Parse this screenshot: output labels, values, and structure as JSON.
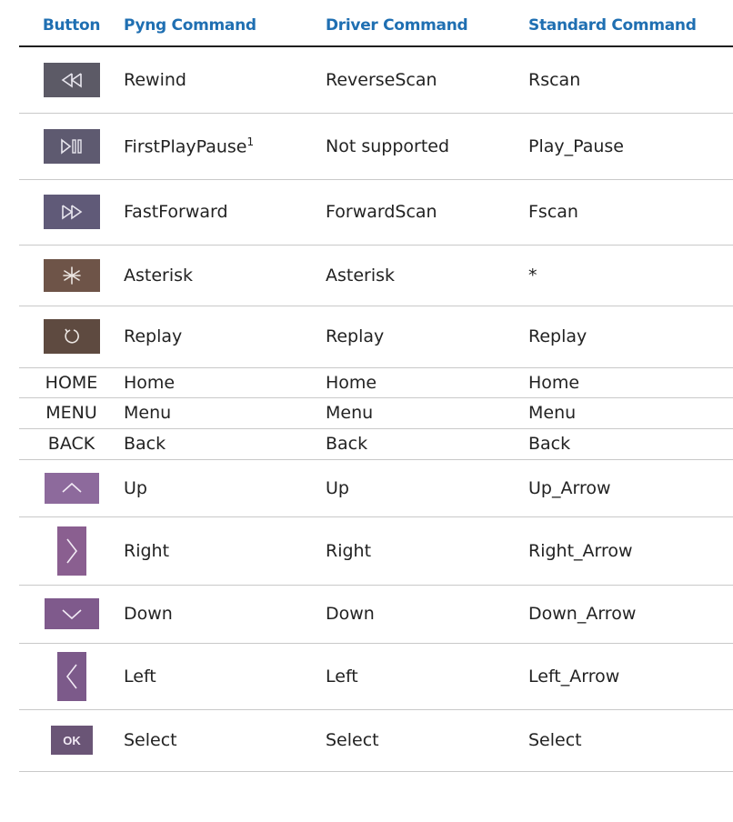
{
  "table": {
    "headers": [
      "Button",
      "Pyng Command",
      "Driver Command",
      "Standard Command"
    ],
    "rows": [
      {
        "button_icon": "rewind-icon",
        "pyng": "Rewind",
        "driver": "ReverseScan",
        "standard": "Rscan",
        "color": "#5c5a66"
      },
      {
        "button_icon": "play-pause-icon",
        "pyng": "FirstPlayPause",
        "pyng_footnote": "1",
        "driver": "Not supported",
        "standard": "Play_Pause",
        "color": "#5e5a70"
      },
      {
        "button_icon": "fast-forward-icon",
        "pyng": "FastForward",
        "driver": "ForwardScan",
        "standard": "Fscan",
        "color": "#605a78"
      },
      {
        "button_icon": "asterisk-icon",
        "pyng": "Asterisk",
        "driver": "Asterisk",
        "standard": "*",
        "color": "#6e5448"
      },
      {
        "button_icon": "replay-icon",
        "pyng": "Replay",
        "driver": "Replay",
        "standard": "Replay",
        "color": "#5e4a40"
      },
      {
        "button_text": "HOME",
        "pyng": "Home",
        "driver": "Home",
        "standard": "Home"
      },
      {
        "button_text": "MENU",
        "pyng": "Menu",
        "driver": "Menu",
        "standard": "Menu"
      },
      {
        "button_text": "BACK",
        "pyng": "Back",
        "driver": "Back",
        "standard": "Back"
      },
      {
        "button_icon": "up-arrow-icon",
        "pyng": "Up",
        "driver": "Up",
        "standard": "Up_Arrow",
        "color": "#8d6a9c"
      },
      {
        "button_icon": "right-arrow-icon",
        "pyng": "Right",
        "driver": "Right",
        "standard": "Right_Arrow",
        "color": "#8a5f90"
      },
      {
        "button_icon": "down-arrow-icon",
        "pyng": "Down",
        "driver": "Down",
        "standard": "Down_Arrow",
        "color": "#7f5a8c"
      },
      {
        "button_icon": "left-arrow-icon",
        "pyng": "Left",
        "driver": "Left",
        "standard": "Left_Arrow",
        "color": "#7c5a8a"
      },
      {
        "button_icon": "ok-icon",
        "button_icon_text": "OK",
        "pyng": "Select",
        "driver": "Select",
        "standard": "Select",
        "color": "#6a5576"
      }
    ]
  }
}
